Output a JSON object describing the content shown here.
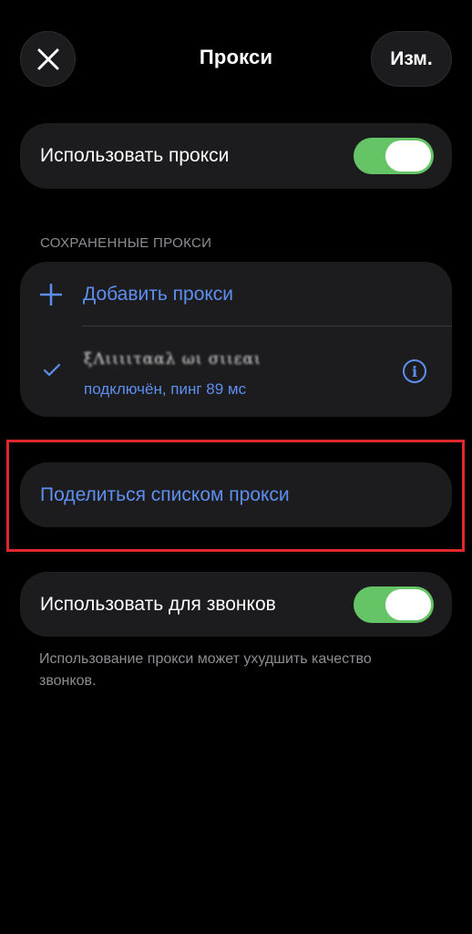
{
  "header": {
    "title": "Прокси",
    "close_icon": "close-icon",
    "edit_label": "Изм."
  },
  "use_proxy": {
    "label": "Использовать прокси",
    "enabled": true
  },
  "saved": {
    "section_title": "СОХРАНЕННЫЕ ПРОКСИ",
    "add_label": "Добавить прокси",
    "proxy_item": {
      "name": "ξΛιιιιτααλ ωι σιιεαι",
      "status": "подключён, пинг 89 мс",
      "selected": true
    }
  },
  "share": {
    "label": "Поделиться списком прокси"
  },
  "use_for_calls": {
    "label": "Использовать для звонков",
    "enabled": true
  },
  "footer_note": "Использование прокси может ухудшить качество звонков.",
  "colors": {
    "background": "#000000",
    "card": "#1c1c1e",
    "accent_blue": "#5e8ff0",
    "toggle_on": "#65c466",
    "highlight_red": "#e0262f",
    "secondary_text": "#8d8d93"
  }
}
